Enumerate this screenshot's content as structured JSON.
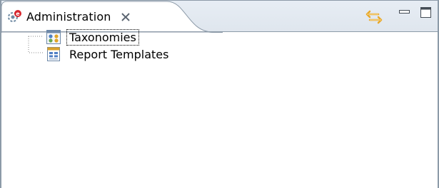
{
  "view": {
    "tab_title": "Administration",
    "icons": {
      "tab": "administration-view-icon",
      "close": "close-icon",
      "sync": "link-with-editor-icon",
      "minimize": "minimize-icon",
      "maximize": "maximize-icon"
    }
  },
  "tree": {
    "items": [
      {
        "label": "Taxonomies",
        "icon": "taxonomy-icon",
        "focused": true
      },
      {
        "label": "Report Templates",
        "icon": "report-template-icon",
        "focused": false
      }
    ]
  },
  "colors": {
    "frame_border": "#8c9aa8",
    "tabbar_bg": "#dfe6ee",
    "sync_accent": "#e8a92b"
  }
}
